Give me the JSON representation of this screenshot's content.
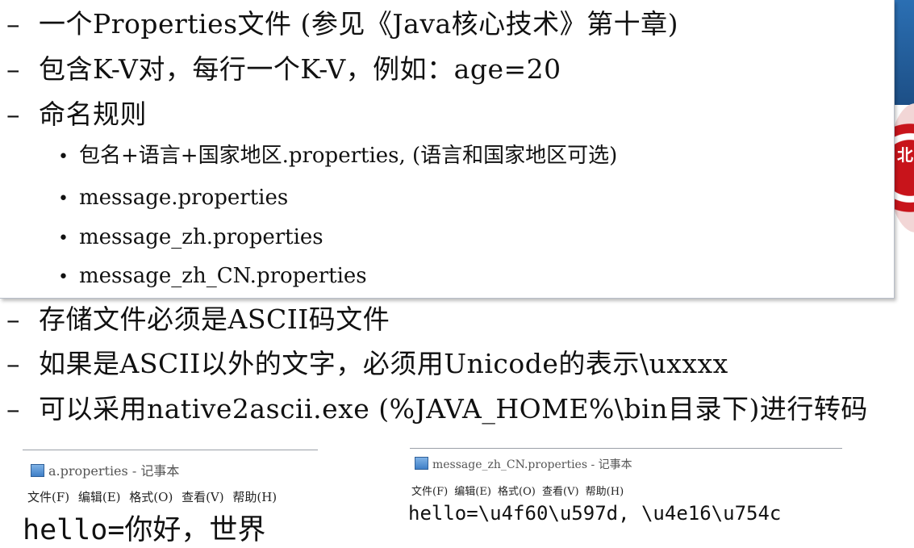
{
  "box_lines": [
    "一个Properties文件 (参见《Java核心技术》第十章)",
    "包含K-V对，每行一个K-V，例如：age=20",
    "命名规则"
  ],
  "bullets": [
    "包名+语言+国家地区.properties, (语言和国家地区可选)",
    "message.properties",
    "message_zh.properties",
    "message_zh_CN.properties"
  ],
  "lower_lines": [
    "存储文件必须是ASCII码文件",
    "如果是ASCII以外的文字，必须用Unicode的表示\\uxxxx",
    "可以采用native2ascii.exe (%JAVA_HOME%\\bin目录下)进行转码"
  ],
  "dash": "–",
  "bullet_char": "•",
  "notepad_left": {
    "title": "a.properties - 记事本",
    "menu": "文件(F) 编辑(E) 格式(O) 查看(V) 帮助(H)",
    "content": "hello=你好，世界"
  },
  "notepad_right": {
    "title": "message_zh_CN.properties - 记事本",
    "menu": "文件(F) 编辑(E) 格式(O) 查看(V) 帮助(H)",
    "content": "hello=\\u4f60\\u597d, \\u4e16\\u754c"
  },
  "colors": {
    "seal": "#c8141b",
    "strip": "#2b6fb3"
  }
}
